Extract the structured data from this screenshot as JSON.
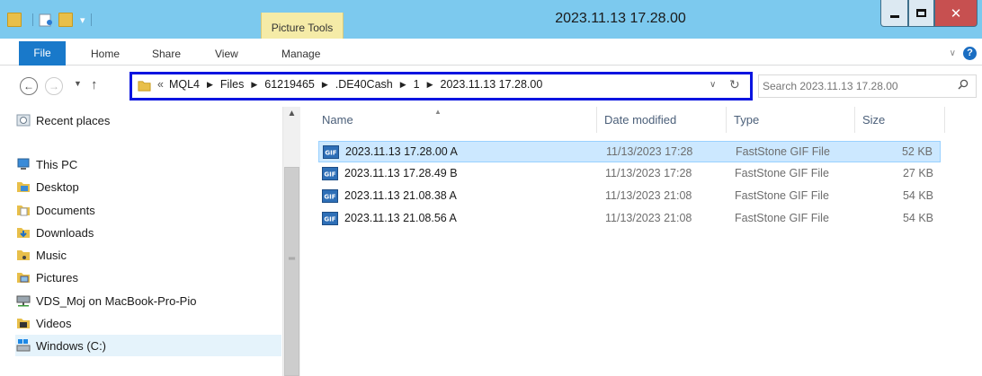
{
  "window": {
    "title": "2023.11.13 17.28.00",
    "contextual_tab": "Picture Tools"
  },
  "ribbon": {
    "tabs": [
      "File",
      "Home",
      "Share",
      "View",
      "Manage"
    ]
  },
  "address": {
    "lead": "«",
    "crumbs": [
      "MQL4",
      "Files",
      "61219465",
      ".DE40Cash",
      "1",
      "2023.11.13 17.28.00"
    ]
  },
  "search": {
    "placeholder": "Search 2023.11.13 17.28.00"
  },
  "nav_pane": {
    "items": [
      {
        "label": "Recent places",
        "icon": "recent-places-icon"
      },
      {
        "label": "This PC",
        "icon": "computer-icon"
      },
      {
        "label": "Desktop",
        "icon": "desktop-folder-icon"
      },
      {
        "label": "Documents",
        "icon": "documents-folder-icon"
      },
      {
        "label": "Downloads",
        "icon": "downloads-folder-icon"
      },
      {
        "label": "Music",
        "icon": "music-folder-icon"
      },
      {
        "label": "Pictures",
        "icon": "pictures-folder-icon"
      },
      {
        "label": "VDS_Moj on MacBook-Pro-Pio",
        "icon": "network-drive-icon"
      },
      {
        "label": "Videos",
        "icon": "videos-folder-icon"
      },
      {
        "label": "Windows (C:)",
        "icon": "local-disk-icon",
        "selected": true
      }
    ]
  },
  "file_list": {
    "columns": [
      "Name",
      "Date modified",
      "Type",
      "Size"
    ],
    "rows": [
      {
        "name": "2023.11.13 17.28.00 A",
        "date": "11/13/2023 17:28",
        "type": "FastStone GIF File",
        "size": "52 KB",
        "selected": true
      },
      {
        "name": "2023.11.13 17.28.49 B",
        "date": "11/13/2023 17:28",
        "type": "FastStone GIF File",
        "size": "27 KB"
      },
      {
        "name": "2023.11.13 21.08.38 A",
        "date": "11/13/2023 21:08",
        "type": "FastStone GIF File",
        "size": "54 KB"
      },
      {
        "name": "2023.11.13 21.08.56 A",
        "date": "11/13/2023 21:08",
        "type": "FastStone GIF File",
        "size": "54 KB"
      }
    ]
  },
  "colors": {
    "titlebar": "#7cc9ee",
    "file_tab": "#1979ca",
    "address_highlight": "#0a14e0",
    "selection": "#cce8ff",
    "close_button": "#c75050"
  }
}
